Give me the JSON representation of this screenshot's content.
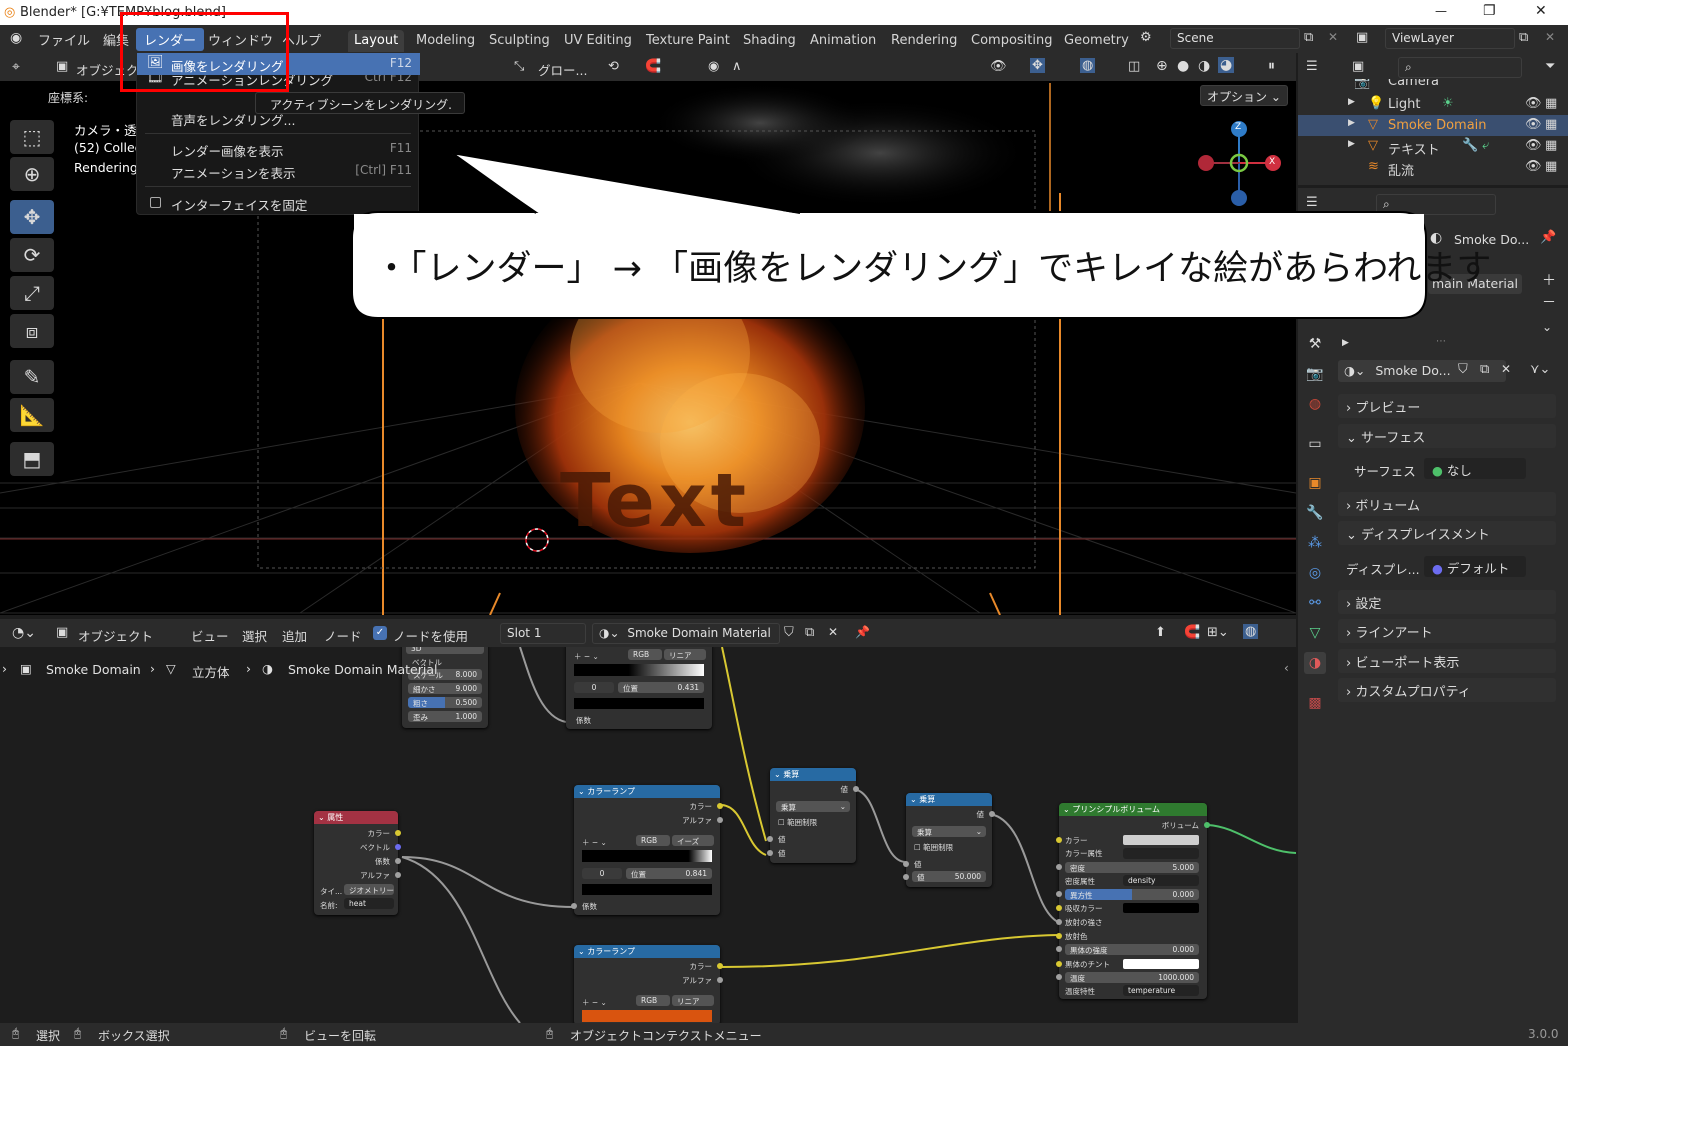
{
  "titlebar": {
    "title": "Blender* [G:¥TEMP¥blog.blend]",
    "min": "—",
    "restore": "❐",
    "close": "✕"
  },
  "menubar": {
    "items": [
      "ファイル",
      "編集",
      "レンダー",
      "ウィンドウ",
      "ヘルプ"
    ],
    "workspaces": [
      "Layout",
      "Modeling",
      "Sculpting",
      "UV Editing",
      "Texture Paint",
      "Shading",
      "Animation",
      "Rendering",
      "Compositing",
      "Geometry"
    ],
    "scene": "Scene",
    "viewlayer": "ViewLayer"
  },
  "viewport_header": {
    "mode": "オブジェクト",
    "transform": "グロー...",
    "coord_label": "座標系:",
    "options": "オプション"
  },
  "viewport_overlay": {
    "line1": "カメラ・透",
    "line2": "(52) Collec",
    "line3": "Rendering",
    "fire_text": "Text"
  },
  "render_menu": {
    "items": [
      {
        "label": "画像をレンダリング",
        "shortcut": "F12",
        "highlighted": true
      },
      {
        "label": "アニメーションレンダリング",
        "shortcut": "Ctrl F12"
      },
      {
        "label": "音声をレンダリング...",
        "shortcut": ""
      },
      {
        "label": "レンダー画像を表示",
        "shortcut": "F11"
      },
      {
        "label": "アニメーションを表示",
        "shortcut": "[Ctrl] F11"
      },
      {
        "label": "インターフェイスを固定",
        "shortcut": ""
      }
    ],
    "tooltip": "アクティブシーンをレンダリング."
  },
  "callout": {
    "text": "・「レンダー」 → 「画像をレンダリング」でキレイな絵があらわれます"
  },
  "outliner": {
    "rows": [
      {
        "label": "Camera",
        "selected": false
      },
      {
        "label": "Light",
        "selected": false
      },
      {
        "label": "Smoke Domain",
        "selected": true
      },
      {
        "label": "テキスト",
        "selected": false
      },
      {
        "label": "乱流",
        "selected": false
      }
    ]
  },
  "properties": {
    "object_name": "Smoke Do...",
    "material_slot": "main Material",
    "material_name": "Smoke Do...",
    "sections": [
      {
        "label": "プレビュー",
        "expanded": false
      },
      {
        "label": "サーフェス",
        "expanded": true
      },
      {
        "label": "ボリューム",
        "expanded": false
      },
      {
        "label": "ディスプレイスメント",
        "expanded": true
      },
      {
        "label": "設定",
        "expanded": false
      },
      {
        "label": "ラインアート",
        "expanded": false
      },
      {
        "label": "ビューポート表示",
        "expanded": false
      },
      {
        "label": "カスタムプロパティ",
        "expanded": false
      }
    ],
    "surface_label": "サーフェス",
    "surface_value": "なし",
    "displacement_label": "ディスプレ...",
    "displacement_value": "デフォルト"
  },
  "node_header": {
    "mode": "オブジェクト",
    "menus": [
      "ビュー",
      "選択",
      "追加",
      "ノード"
    ],
    "use_nodes": "ノードを使用",
    "slot": "Slot 1",
    "material": "Smoke Domain Material"
  },
  "breadcrumb": {
    "object": "Smoke Domain",
    "mesh": "立方体",
    "material": "Smoke Domain Material"
  },
  "nodes": {
    "noise": {
      "type": "3D",
      "vector": "ベクトル",
      "scale_l": "スケール",
      "scale_v": "8.000",
      "detail_l": "細かさ",
      "detail_v": "9.000",
      "rough_l": "粗さ",
      "rough_v": "0.500",
      "dist_l": "歪み",
      "dist_v": "1.000"
    },
    "ramp_top": {
      "mode": "RGB",
      "interp": "リニア",
      "idx": "0",
      "pos_l": "位置",
      "pos_v": "0.431",
      "fac": "係数"
    },
    "attr": {
      "title": "属性",
      "color": "カラー",
      "vector": "ベクトル",
      "fac": "係数",
      "alpha": "アルファ",
      "type_l": "タイ...",
      "type_v": "ジオメトリー",
      "name_l": "名前:",
      "name_v": "heat"
    },
    "ramp1": {
      "title": "カラーランプ",
      "color": "カラー",
      "alpha": "アルファ",
      "mode": "RGB",
      "interp": "イーズ",
      "idx": "0",
      "pos_l": "位置",
      "pos_v": "0.841",
      "fac": "係数"
    },
    "ramp2": {
      "title": "カラーランプ",
      "color": "カラー",
      "alpha": "アルファ",
      "mode": "RGB",
      "interp": "リニア"
    },
    "mult1": {
      "title": "乗算",
      "value": "値",
      "op": "乗算",
      "clamp": "範囲制限",
      "in1": "値",
      "in2": "値"
    },
    "mult2": {
      "title": "乗算",
      "value": "値",
      "op": "乗算",
      "clamp": "範囲制限",
      "in1": "値",
      "in2_l": "値",
      "in2_v": "50.000"
    },
    "pv": {
      "title": "プリンシプルボリューム",
      "out": "ボリューム",
      "color": "カラー",
      "color_attr": "カラー属性",
      "density_l": "密度",
      "density_v": "5.000",
      "density_attr_l": "密度属性",
      "density_attr_v": "density",
      "aniso_l": "異方性",
      "aniso_v": "0.000",
      "absorb": "吸収カラー",
      "emit_str": "放射の強さ",
      "emit_col": "放射色",
      "bb_l": "黒体の強度",
      "bb_v": "0.000",
      "bb_tint": "黒体のチント",
      "temp_l": "温度",
      "temp_v": "1000.000",
      "temp_attr_l": "温度特性",
      "temp_attr_v": "temperature"
    }
  },
  "status": {
    "select": "選択",
    "box_select": "ボックス選択",
    "rotate": "ビューを回転",
    "context": "オブジェクトコンテクストメニュー",
    "version": "3.0.0"
  },
  "colors": {
    "accent": "#4772b3",
    "callout_border": "#000000",
    "red_box": "#ff0000",
    "pv_header": "#2f7a2f",
    "ramp_header": "#276aa3",
    "attr_header": "#a33243"
  }
}
